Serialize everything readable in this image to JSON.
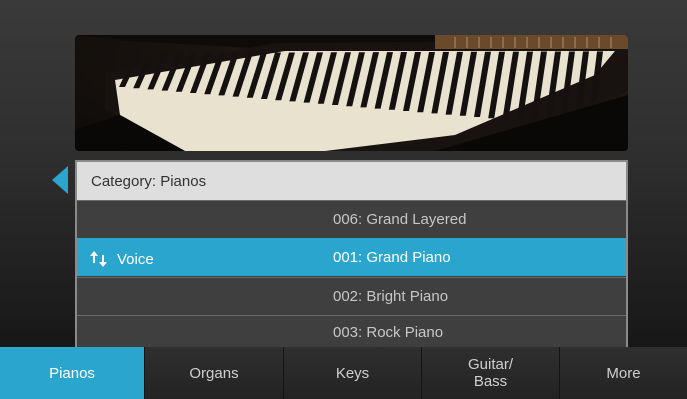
{
  "category": {
    "label": "Category: Pianos"
  },
  "voice": {
    "label": "Voice",
    "items": [
      {
        "text": "006: Grand Layered",
        "selected": false
      },
      {
        "text": "001: Grand Piano",
        "selected": true
      },
      {
        "text": "002: Bright Piano",
        "selected": false
      },
      {
        "text": "003: Rock Piano",
        "selected": false
      }
    ]
  },
  "tabs": [
    {
      "label": "Pianos",
      "active": true
    },
    {
      "label": "Organs",
      "active": false
    },
    {
      "label": "Keys",
      "active": false
    },
    {
      "label": "Guitar/\nBass",
      "active": false
    },
    {
      "label": "More",
      "active": false
    }
  ],
  "colors": {
    "accent": "#2aa5cd",
    "background": "#2e2e2e",
    "category_bar": "#dedede"
  },
  "icons": {
    "prev": "triangle-left-icon",
    "sort": "up-down-arrows-icon"
  }
}
